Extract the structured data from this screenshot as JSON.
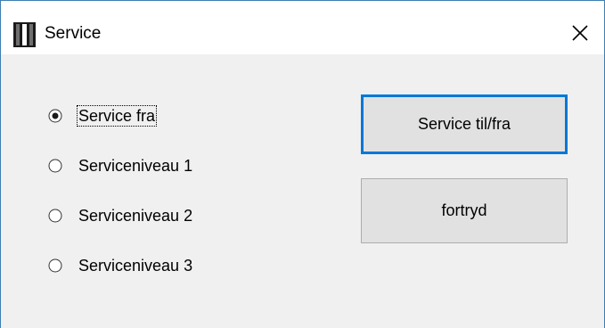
{
  "window": {
    "title": "Service",
    "icon": "app-icon",
    "close_icon": "close-icon"
  },
  "options": [
    {
      "label": "Service fra",
      "checked": true
    },
    {
      "label": "Serviceniveau 1",
      "checked": false
    },
    {
      "label": "Serviceniveau 2",
      "checked": false
    },
    {
      "label": "Serviceniveau 3",
      "checked": false
    }
  ],
  "buttons": {
    "primary_label": "Service til/fra",
    "cancel_label": "fortryd"
  },
  "colors": {
    "accent": "#0078d7",
    "window_border": "#3c7fb1",
    "dialog_bg": "#f0f0f0",
    "button_bg": "#e1e1e1"
  }
}
